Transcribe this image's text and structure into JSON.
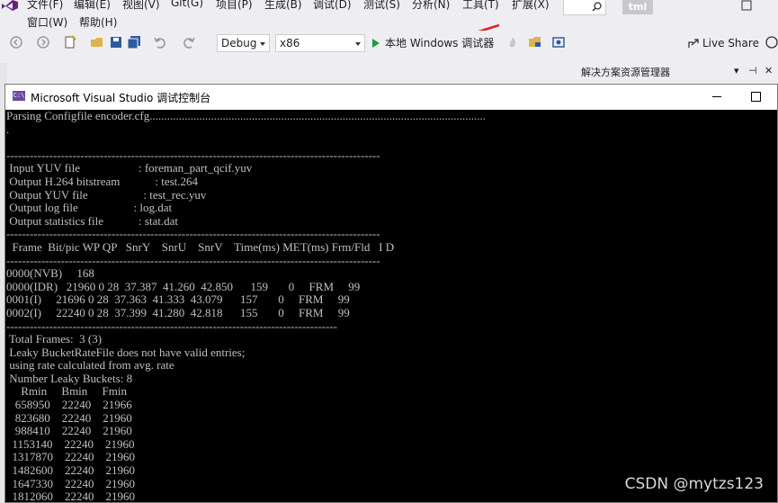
{
  "menubar": {
    "row1": [
      "文件(F)",
      "编辑(E)",
      "视图(V)",
      "Git(G)",
      "项目(P)",
      "生成(B)",
      "调试(D)",
      "测试(S)",
      "分析(N)",
      "工具(T)",
      "扩展(X)"
    ],
    "row2": [
      "窗口(W)",
      "帮助(H)"
    ],
    "user_badge": "tml"
  },
  "toolbar": {
    "config": "Debug",
    "platform": "x86",
    "run_label": "本地 Windows 调试器",
    "live_share": "Live Share"
  },
  "solution_explorer": {
    "title": "解决方案资源管理器"
  },
  "console": {
    "title": "Microsoft Visual Studio 调试控制台",
    "icon_text": "C:\\",
    "lines": [
      "Parsing Configfile encoder.cfg...................................................................................................................",
      ".",
      "",
      "------------------------------------------------------------------------------------------------",
      " Input YUV file                    : foreman_part_qcif.yuv",
      " Output H.264 bitstream            : test.264",
      " Output YUV file                   : test_rec.yuv",
      " Output log file                   : log.dat",
      " Output statistics file            : stat.dat",
      "------------------------------------------------------------------------------------------------",
      "  Frame  Bit/pic WP QP   SnrY    SnrU    SnrV    Time(ms) MET(ms) Frm/Fld   I D",
      "------------------------------------------------------------------------------------------------",
      "0000(NVB)     168",
      "0000(IDR)   21960 0 28  37.387  41.260  42.850      159       0     FRM     99",
      "0001(I)     21696 0 28  37.363  41.333  43.079      157       0     FRM     99",
      "0002(I)     22240 0 28  37.399  41.280  42.818      155       0     FRM     99",
      "-------------------------------------------------------------------------------------",
      " Total Frames:  3 (3)",
      " Leaky BucketRateFile does not have valid entries;",
      " using rate calculated from avg. rate",
      " Number Leaky Buckets: 8",
      "     Rmin     Bmin     Fmin",
      "   658950    22240    21966",
      "   823680    22240    21960",
      "   988410    22240    21960",
      "  1153140    22240    21960",
      "  1317870    22240    21960",
      "  1482600    22240    21960",
      "  1647330    22240    21960",
      "  1812060    22240    21960"
    ]
  },
  "watermark": "CSDN @mytzs123",
  "colors": {
    "chrome_bg": "#eeeef2",
    "console_bg": "#000000",
    "console_text": "#c0c0c0",
    "play_green": "#1d9c35",
    "annotation_red": "#e02020"
  }
}
